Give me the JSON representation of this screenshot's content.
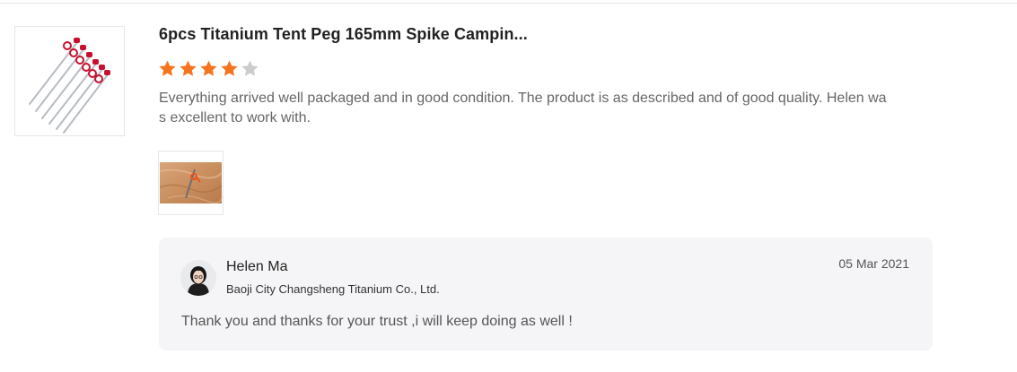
{
  "review": {
    "product_title": "6pcs Titanium Tent Peg 165mm Spike Campin...",
    "rating": 4,
    "rating_max": 5,
    "text": "Everything arrived well packaged and in good condition. The product is as described and of good quality. Helen was excellent to work with.",
    "product_thumbnail_icon": "tent-pegs-image",
    "photos": [
      {
        "icon": "tent-peg-on-wood-photo"
      }
    ]
  },
  "reply": {
    "seller_name": "Helen Ma",
    "seller_company": "Baoji City Changsheng Titanium Co., Ltd.",
    "date": "05 Mar 2021",
    "text": "Thank you and thanks for your trust ,i will keep doing as well !"
  },
  "colors": {
    "star_filled": "#f7741f",
    "star_empty": "#cccccc",
    "reply_background": "#f5f5f7"
  }
}
